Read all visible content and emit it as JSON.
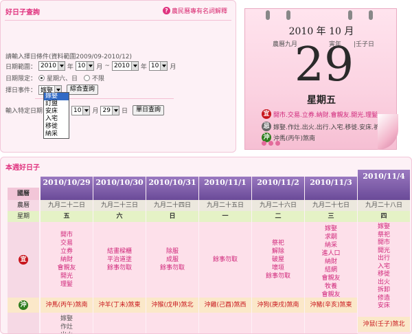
{
  "query": {
    "title": "好日子查詢",
    "help": "農民曆專有名詞解釋",
    "note": "請輸入擇日條件(資料範圍2009/09-2010/12)",
    "range_label": "日期範圍：",
    "range_start_year": "2010",
    "range_start_month": "10",
    "year_suffix": "年",
    "month_suffix": "月",
    "tilde": "~",
    "range_end_year": "2010",
    "range_end_month": "10",
    "limit_label": "日期限定：",
    "limit_opt1": "星期六、日",
    "limit_opt2": "不限",
    "event_label": "擇日事件：",
    "event_value": "嫁娶",
    "event_button": "綜合查詢",
    "event_options": [
      "嫁娶",
      "訂盟",
      "安床",
      "入宅",
      "移徙",
      "納采"
    ],
    "specific_label": "輸入特定日期",
    "specific_month": "10",
    "specific_day": "29",
    "day_suffix": "日",
    "specific_button": "單日查詢"
  },
  "calendar": {
    "year_month": "2010 年 10 月",
    "lunar_left": "農曆九月",
    "lunar_right": "|壬子日",
    "year_stem": "寅年",
    "day": "29",
    "weekday": "星期五",
    "yi_badge": "宜",
    "yi_text": "開市.交易.立券.納財.會親友.開光.理髮.",
    "ji_badge": "忌",
    "ji_text": "嫁娶.作灶.出火.出行.入宅.移徙.安床.祈福.",
    "chong_badge": "沖",
    "chong_text": "沖馬(丙午)煞南"
  },
  "good_days": {
    "title": "本週好日子",
    "labels": {
      "solar": "國曆",
      "lunar": "農曆",
      "week": "星期",
      "yi": "宜",
      "chong": "沖"
    },
    "days": [
      {
        "date": "2010/10/29",
        "lunar": "九月二十二日",
        "week": "五",
        "yi": [
          "開市",
          "交易",
          "立券",
          "納財",
          "會親友",
          "開光",
          "理髮"
        ],
        "chong": "沖馬(丙午)煞南",
        "ji": [
          "嫁娶",
          "作灶",
          "出火"
        ]
      },
      {
        "date": "2010/10/30",
        "lunar": "九月二十三日",
        "week": "六",
        "yi": [
          "結畫樑櫃",
          "平治道塗",
          "餘事勿取"
        ],
        "chong": "沖羊(丁未)煞東",
        "ji": []
      },
      {
        "date": "2010/10/31",
        "lunar": "九月二十四日",
        "week": "日",
        "yi": [
          "除服",
          "成服",
          "餘事勿取"
        ],
        "chong": "沖猴(戊申)煞北",
        "ji": []
      },
      {
        "date": "2010/11/1",
        "lunar": "九月二十五日",
        "week": "一",
        "yi": [
          "餘事勿取"
        ],
        "chong": "沖雞(己酉)煞西",
        "ji": []
      },
      {
        "date": "2010/11/2",
        "lunar": "九月二十六日",
        "week": "二",
        "yi": [
          "祭祀",
          "解除",
          "破屋",
          "壞垣",
          "餘事勿取"
        ],
        "chong": "沖狗(庚戌)煞南",
        "ji": []
      },
      {
        "date": "2010/11/3",
        "lunar": "九月二十七日",
        "week": "三",
        "yi": [
          "嫁娶",
          "求嗣",
          "納采",
          "進人口",
          "納財",
          "結網",
          "會親友",
          "牧養",
          "會親友"
        ],
        "chong": "沖豬(辛亥)煞東",
        "ji": []
      },
      {
        "date": "2010/11/4",
        "lunar": "九月二十八日",
        "week": "四",
        "yi": [
          "嫁娶",
          "祭祀",
          "開市",
          "開光",
          "出行",
          "入宅",
          "移徙",
          "出火",
          "拆卸",
          "修造",
          "安床"
        ],
        "chong": "沖鼠(壬子)煞北",
        "ji": []
      }
    ]
  },
  "colors": {
    "accent": "#e0337f",
    "header_purple": "#7a5aa6",
    "yi_red": "#c8161d",
    "chong_green": "#2f7d1f"
  }
}
